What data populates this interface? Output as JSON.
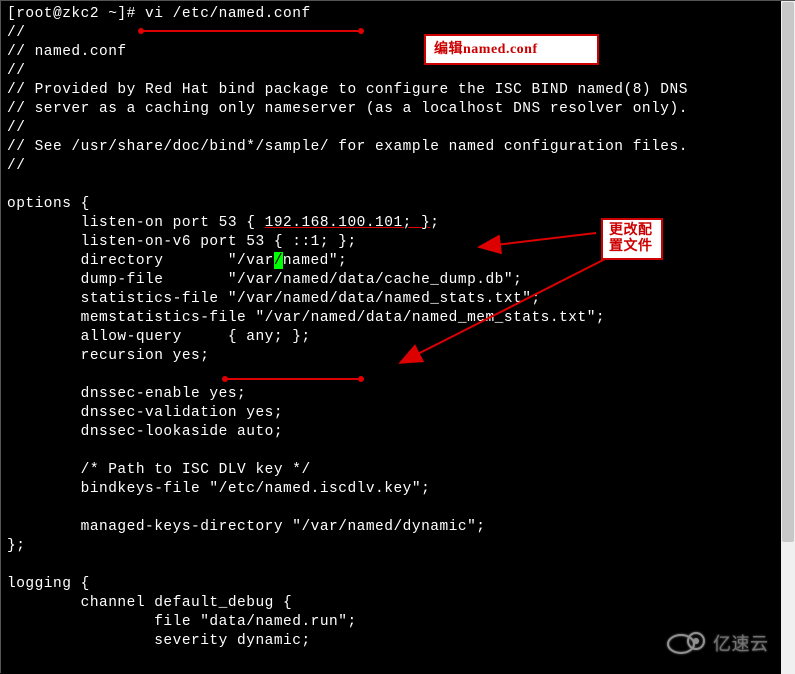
{
  "prompt": "[root@zkc2 ~]# ",
  "command": "vi /etc/named.conf",
  "lines": {
    "l1": "//",
    "l2": "// named.conf",
    "l3": "//",
    "l4": "// Provided by Red Hat bind package to configure the ISC BIND named(8) DNS",
    "l5": "// server as a caching only nameserver (as a localhost DNS resolver only).",
    "l6": "//",
    "l7": "// See /usr/share/doc/bind*/sample/ for example named configuration files.",
    "l8": "//",
    "l10": "options {",
    "l11a": "        listen-on port 53 { ",
    "l11b": "192.168.100.101; }",
    "l11c": ";",
    "l12": "        listen-on-v6 port 53 { ::1; };",
    "l13a": "        directory       \"/var",
    "l13b": "named\";",
    "l14": "        dump-file       \"/var/named/data/cache_dump.db\";",
    "l15": "        statistics-file \"/var/named/data/named_stats.txt\";",
    "l16": "        memstatistics-file \"/var/named/data/named_mem_stats.txt\";",
    "l17": "        allow-query     { any; };",
    "l18": "        recursion yes;",
    "l20": "        dnssec-enable yes;",
    "l21": "        dnssec-validation yes;",
    "l22": "        dnssec-lookaside auto;",
    "l24": "        /* Path to ISC DLV key */",
    "l25": "        bindkeys-file \"/etc/named.iscdlv.key\";",
    "l27": "        managed-keys-directory \"/var/named/dynamic\";",
    "l28": "};",
    "l30": "logging {",
    "l31": "        channel default_debug {",
    "l32": "                file \"data/named.run\";",
    "l33": "                severity dynamic;"
  },
  "annotations": {
    "edit_label": "编辑named.conf",
    "change_label": "更改配置文件"
  },
  "watermark": "亿速云"
}
